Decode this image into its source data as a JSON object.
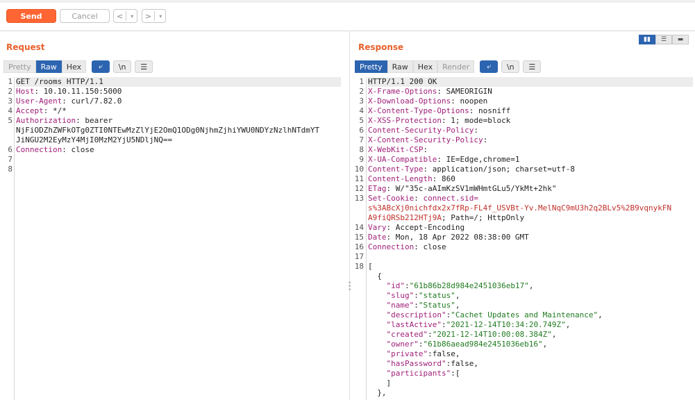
{
  "toolbar": {
    "send_label": "Send",
    "cancel_label": "Cancel",
    "back_label": "<",
    "forward_label": ">"
  },
  "request": {
    "title": "Request",
    "tabs": [
      {
        "label": "Pretty",
        "state": "disabled"
      },
      {
        "label": "Raw",
        "state": "active"
      },
      {
        "label": "Hex",
        "state": "normal"
      }
    ],
    "newline_label": "\\n",
    "lines": [
      {
        "n": "1",
        "text": "GET /rooms HTTP/1.1"
      },
      {
        "n": "2",
        "key": "Host",
        "value": " 10.10.11.150:5000"
      },
      {
        "n": "3",
        "key": "User-Agent",
        "value": " curl/7.82.0"
      },
      {
        "n": "4",
        "key": "Accept",
        "value": " */*"
      },
      {
        "n": "5",
        "key": "Authorization",
        "value": " bearer"
      },
      {
        "n": "",
        "text": "NjFiODZhZWFkOTg0ZTI0NTEwMzZlYjE2OmQ1ODg0NjhmZjhiYWU0NDYzNzlhNTdmYT"
      },
      {
        "n": "",
        "text": "JiNGU2M2EyMzY4MjI0MzM2YjU5NDljNQ=="
      },
      {
        "n": "6",
        "key": "Connection",
        "value": " close"
      },
      {
        "n": "7",
        "text": ""
      },
      {
        "n": "8",
        "text": ""
      }
    ]
  },
  "response": {
    "title": "Response",
    "tabs": [
      {
        "label": "Pretty",
        "state": "active"
      },
      {
        "label": "Raw",
        "state": "normal"
      },
      {
        "label": "Hex",
        "state": "normal"
      },
      {
        "label": "Render",
        "state": "disabled"
      }
    ],
    "newline_label": "\\n",
    "lines": [
      {
        "n": "1",
        "text": "HTTP/1.1 200 OK"
      },
      {
        "n": "2",
        "key": "X-Frame-Options",
        "value": " SAMEORIGIN"
      },
      {
        "n": "3",
        "key": "X-Download-Options",
        "value": " noopen"
      },
      {
        "n": "4",
        "key": "X-Content-Type-Options",
        "value": " nosniff"
      },
      {
        "n": "5",
        "key": "X-XSS-Protection",
        "value": " 1; mode=block"
      },
      {
        "n": "6",
        "key": "Content-Security-Policy",
        "value": ""
      },
      {
        "n": "7",
        "key": "X-Content-Security-Policy",
        "value": ""
      },
      {
        "n": "8",
        "key": "X-WebKit-CSP",
        "value": ""
      },
      {
        "n": "9",
        "key": "X-UA-Compatible",
        "value": " IE=Edge,chrome=1"
      },
      {
        "n": "10",
        "key": "Content-Type",
        "value": " application/json; charset=utf-8"
      },
      {
        "n": "11",
        "key": "Content-Length",
        "value": " 860"
      },
      {
        "n": "12",
        "key": "ETag",
        "value": " W/\"35c-aAImKzSV1mWHmtGLu5/YkMt+2hk\""
      },
      {
        "n": "13",
        "key": "Set-Cookie",
        "value": " ",
        "cookie": "connect.sid="
      },
      {
        "n": "",
        "cookie": "s%3ABcXj0nichfdx2x7fRp-FL4f_USVBt-Yv.MelNqC9mU3h2q2BLv5%2B9vqnykFN"
      },
      {
        "n": "",
        "cookie": "A9fiQRSb212HTj9A",
        "value": "; Path=/; HttpOnly"
      },
      {
        "n": "14",
        "key": "Vary",
        "value": " Accept-Encoding"
      },
      {
        "n": "15",
        "key": "Date",
        "value": " Mon, 18 Apr 2022 08:38:00 GMT"
      },
      {
        "n": "16",
        "key": "Connection",
        "value": " close"
      },
      {
        "n": "17",
        "text": ""
      },
      {
        "n": "18",
        "text": "["
      },
      {
        "n": "",
        "text": "  {"
      },
      {
        "n": "",
        "indent": "    ",
        "jkey": "\"id\"",
        "jval": "\"61b86b28d984e2451036eb17\"",
        "tail": ","
      },
      {
        "n": "",
        "indent": "    ",
        "jkey": "\"slug\"",
        "jval": "\"status\"",
        "tail": ","
      },
      {
        "n": "",
        "indent": "    ",
        "jkey": "\"name\"",
        "jval": "\"Status\"",
        "tail": ","
      },
      {
        "n": "",
        "indent": "    ",
        "jkey": "\"description\"",
        "jval": "\"Cachet Updates and Maintenance\"",
        "tail": ","
      },
      {
        "n": "",
        "indent": "    ",
        "jkey": "\"lastActive\"",
        "jval": "\"2021-12-14T10:34:20.749Z\"",
        "tail": ","
      },
      {
        "n": "",
        "indent": "    ",
        "jkey": "\"created\"",
        "jval": "\"2021-12-14T10:00:08.384Z\"",
        "tail": ","
      },
      {
        "n": "",
        "indent": "    ",
        "jkey": "\"owner\"",
        "jval": "\"61b86aead984e2451036eb16\"",
        "tail": ","
      },
      {
        "n": "",
        "indent": "    ",
        "jkey": "\"private\"",
        "plain": ":false,"
      },
      {
        "n": "",
        "indent": "    ",
        "jkey": "\"hasPassword\"",
        "plain": ":false,"
      },
      {
        "n": "",
        "indent": "    ",
        "jkey": "\"participants\"",
        "plain": ":["
      },
      {
        "n": "",
        "text": "    ]"
      },
      {
        "n": "",
        "text": "  },"
      }
    ]
  },
  "layout_buttons": [
    "split-horizontal",
    "split-vertical",
    "tabs"
  ],
  "colors": {
    "accent": "#ff6633",
    "selected": "#2c64b0",
    "header_key": "#a0207a",
    "string": "#1f7a1f",
    "cookie": "#c0302a"
  }
}
